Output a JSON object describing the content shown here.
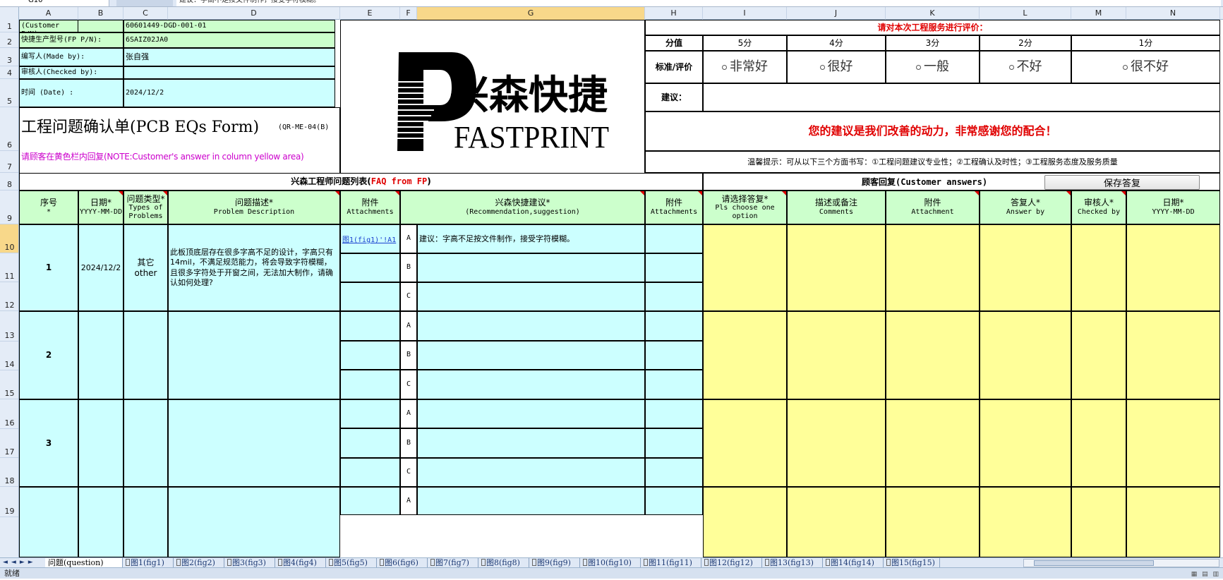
{
  "formula_bar": {
    "name_box": "G10",
    "formula_text": "建议：字高不足按文件制作，接受字符模糊。"
  },
  "columns": [
    "A",
    "B",
    "C",
    "D",
    "E",
    "F",
    "G",
    "H",
    "I",
    "J",
    "K",
    "L",
    "M",
    "N"
  ],
  "rows": [
    "1",
    "2",
    "3",
    "4",
    "5",
    "6",
    "7",
    "8",
    "9",
    "10",
    "11",
    "12",
    "13",
    "14",
    "15",
    "16",
    "17",
    "18",
    "19"
  ],
  "info": {
    "customer_pn_label": "顾客型号(Customer P/N):",
    "customer_pn_value": "60601449-DGD-001-01",
    "fp_pn_label": "快捷生产型号(FP P/N):",
    "fp_pn_value": "6SAIZ02JA0",
    "made_by_label": "编写人(Made by):",
    "made_by_value": "张自强",
    "checked_by_label": "审核人(Checked by):",
    "checked_by_value": "",
    "date_label": "时间 (Date) :",
    "date_value": "2024/12/2"
  },
  "form_title": "工程问题确认单(PCB EQs Form)",
  "form_code": "(QR-ME-04(B)",
  "note_text": "请顾客在黄色栏内回复(NOTE:Customer's answer in column yellow area)",
  "logo": {
    "chinese": "兴森快捷",
    "english": "FASTPRINT"
  },
  "rating": {
    "title": "请对本次工程服务进行评价：",
    "score_label": "分值",
    "scores": [
      "5分",
      "4分",
      "3分",
      "2分",
      "1分"
    ],
    "criteria_label": "标准/评价",
    "options": [
      "非常好",
      "很好",
      "一般",
      "不好",
      "很不好"
    ],
    "suggestion_label": "建议：",
    "thanks_text": "您的建议是我们改善的动力，非常感谢您的配合！",
    "tip_text": "温馨提示：可从以下三个方面书写：①工程问题建议专业性；②工程确认及时性；③工程服务态度及服务质量"
  },
  "faq_header": {
    "prefix": "兴森工程师问题列表(",
    "red": "FAQ from FP",
    "suffix": ")"
  },
  "customer_header": "顾客回复(Customer answers)",
  "save_button": "保存答复",
  "headers": {
    "seq": {
      "cn": "序号",
      "en": "*"
    },
    "date": {
      "cn": "日期*",
      "en": "YYYY-MM-DD"
    },
    "type": {
      "cn": "问题类型*",
      "en": "Types of Problems"
    },
    "desc": {
      "cn": "问题描述*",
      "en": "Problem Description"
    },
    "attach": {
      "cn": "附件",
      "en": "Attachments"
    },
    "rec": {
      "cn": "兴森快捷建议*",
      "en": "(Recommendation,suggestion)"
    },
    "attach2": {
      "cn": "附件",
      "en": "Attachments"
    },
    "choose": {
      "cn": "请选择答复*",
      "en": "Pls choose one option"
    },
    "comments": {
      "cn": "描述或备注",
      "en": "Comments"
    },
    "attachment": {
      "cn": "附件",
      "en": "Attachment"
    },
    "answer_by": {
      "cn": "答复人*",
      "en": "Answer by"
    },
    "checked_by": {
      "cn": "审核人*",
      "en": "Checked by"
    },
    "date2": {
      "cn": "日期*",
      "en": "YYYY-MM-DD"
    }
  },
  "problems": [
    {
      "seq": "1",
      "date": "2024/12/2",
      "type_cn": "其它",
      "type_en": "other",
      "desc": "此板顶底层存在很多字高不足的设计，字高只有14mil，不满足规范能力，将会导致字符模糊，且很多字符处于开窗之间，无法加大制作，请确认如何处理?",
      "attachment_link": "图1(fig1)'!A1",
      "options": [
        "A",
        "B",
        "C"
      ],
      "recommendations": [
        "建议：字高不足按文件制作，接受字符模糊。",
        "",
        ""
      ]
    },
    {
      "seq": "2",
      "date": "",
      "type_cn": "",
      "type_en": "",
      "desc": "",
      "attachment_link": "",
      "options": [
        "A",
        "B",
        "C"
      ],
      "recommendations": [
        "",
        "",
        ""
      ]
    },
    {
      "seq": "3",
      "date": "",
      "type_cn": "",
      "type_en": "",
      "desc": "",
      "attachment_link": "",
      "options": [
        "A",
        "B",
        "C"
      ],
      "recommendations": [
        "",
        "",
        ""
      ]
    },
    {
      "seq": "",
      "options": [
        "A"
      ]
    }
  ],
  "sheet_tabs": [
    "问题(question)",
    "图1(fig1)",
    "图2(fig2)",
    "图3(fig3)",
    "图4(fig4)",
    "图5(fig5)",
    "图6(fig6)",
    "图7(fig7)",
    "图8(fig8)",
    "图9(fig9)",
    "图10(fig10)",
    "图11(fig11)",
    "图12(fig12)",
    "图13(fig13)",
    "图14(fig14)",
    "图15(fig15)"
  ],
  "status": "就绪"
}
